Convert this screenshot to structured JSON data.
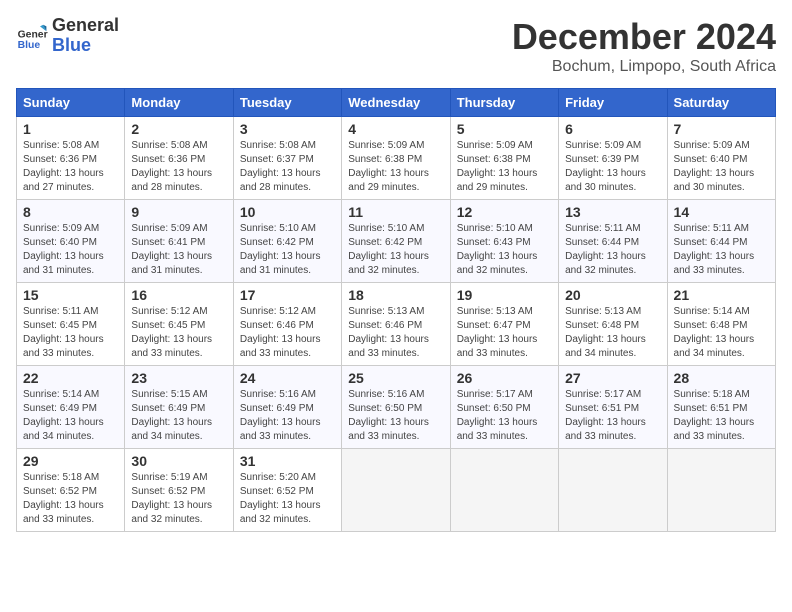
{
  "header": {
    "logo_line1": "General",
    "logo_line2": "Blue",
    "month": "December 2024",
    "location": "Bochum, Limpopo, South Africa"
  },
  "days_of_week": [
    "Sunday",
    "Monday",
    "Tuesday",
    "Wednesday",
    "Thursday",
    "Friday",
    "Saturday"
  ],
  "weeks": [
    [
      {
        "day": "1",
        "sunrise": "5:08 AM",
        "sunset": "6:36 PM",
        "daylight": "13 hours and 27 minutes."
      },
      {
        "day": "2",
        "sunrise": "5:08 AM",
        "sunset": "6:36 PM",
        "daylight": "13 hours and 28 minutes."
      },
      {
        "day": "3",
        "sunrise": "5:08 AM",
        "sunset": "6:37 PM",
        "daylight": "13 hours and 28 minutes."
      },
      {
        "day": "4",
        "sunrise": "5:09 AM",
        "sunset": "6:38 PM",
        "daylight": "13 hours and 29 minutes."
      },
      {
        "day": "5",
        "sunrise": "5:09 AM",
        "sunset": "6:38 PM",
        "daylight": "13 hours and 29 minutes."
      },
      {
        "day": "6",
        "sunrise": "5:09 AM",
        "sunset": "6:39 PM",
        "daylight": "13 hours and 30 minutes."
      },
      {
        "day": "7",
        "sunrise": "5:09 AM",
        "sunset": "6:40 PM",
        "daylight": "13 hours and 30 minutes."
      }
    ],
    [
      {
        "day": "8",
        "sunrise": "5:09 AM",
        "sunset": "6:40 PM",
        "daylight": "13 hours and 31 minutes."
      },
      {
        "day": "9",
        "sunrise": "5:09 AM",
        "sunset": "6:41 PM",
        "daylight": "13 hours and 31 minutes."
      },
      {
        "day": "10",
        "sunrise": "5:10 AM",
        "sunset": "6:42 PM",
        "daylight": "13 hours and 31 minutes."
      },
      {
        "day": "11",
        "sunrise": "5:10 AM",
        "sunset": "6:42 PM",
        "daylight": "13 hours and 32 minutes."
      },
      {
        "day": "12",
        "sunrise": "5:10 AM",
        "sunset": "6:43 PM",
        "daylight": "13 hours and 32 minutes."
      },
      {
        "day": "13",
        "sunrise": "5:11 AM",
        "sunset": "6:44 PM",
        "daylight": "13 hours and 32 minutes."
      },
      {
        "day": "14",
        "sunrise": "5:11 AM",
        "sunset": "6:44 PM",
        "daylight": "13 hours and 33 minutes."
      }
    ],
    [
      {
        "day": "15",
        "sunrise": "5:11 AM",
        "sunset": "6:45 PM",
        "daylight": "13 hours and 33 minutes."
      },
      {
        "day": "16",
        "sunrise": "5:12 AM",
        "sunset": "6:45 PM",
        "daylight": "13 hours and 33 minutes."
      },
      {
        "day": "17",
        "sunrise": "5:12 AM",
        "sunset": "6:46 PM",
        "daylight": "13 hours and 33 minutes."
      },
      {
        "day": "18",
        "sunrise": "5:13 AM",
        "sunset": "6:46 PM",
        "daylight": "13 hours and 33 minutes."
      },
      {
        "day": "19",
        "sunrise": "5:13 AM",
        "sunset": "6:47 PM",
        "daylight": "13 hours and 33 minutes."
      },
      {
        "day": "20",
        "sunrise": "5:13 AM",
        "sunset": "6:48 PM",
        "daylight": "13 hours and 34 minutes."
      },
      {
        "day": "21",
        "sunrise": "5:14 AM",
        "sunset": "6:48 PM",
        "daylight": "13 hours and 34 minutes."
      }
    ],
    [
      {
        "day": "22",
        "sunrise": "5:14 AM",
        "sunset": "6:49 PM",
        "daylight": "13 hours and 34 minutes."
      },
      {
        "day": "23",
        "sunrise": "5:15 AM",
        "sunset": "6:49 PM",
        "daylight": "13 hours and 34 minutes."
      },
      {
        "day": "24",
        "sunrise": "5:16 AM",
        "sunset": "6:49 PM",
        "daylight": "13 hours and 33 minutes."
      },
      {
        "day": "25",
        "sunrise": "5:16 AM",
        "sunset": "6:50 PM",
        "daylight": "13 hours and 33 minutes."
      },
      {
        "day": "26",
        "sunrise": "5:17 AM",
        "sunset": "6:50 PM",
        "daylight": "13 hours and 33 minutes."
      },
      {
        "day": "27",
        "sunrise": "5:17 AM",
        "sunset": "6:51 PM",
        "daylight": "13 hours and 33 minutes."
      },
      {
        "day": "28",
        "sunrise": "5:18 AM",
        "sunset": "6:51 PM",
        "daylight": "13 hours and 33 minutes."
      }
    ],
    [
      {
        "day": "29",
        "sunrise": "5:18 AM",
        "sunset": "6:52 PM",
        "daylight": "13 hours and 33 minutes."
      },
      {
        "day": "30",
        "sunrise": "5:19 AM",
        "sunset": "6:52 PM",
        "daylight": "13 hours and 32 minutes."
      },
      {
        "day": "31",
        "sunrise": "5:20 AM",
        "sunset": "6:52 PM",
        "daylight": "13 hours and 32 minutes."
      },
      null,
      null,
      null,
      null
    ]
  ]
}
